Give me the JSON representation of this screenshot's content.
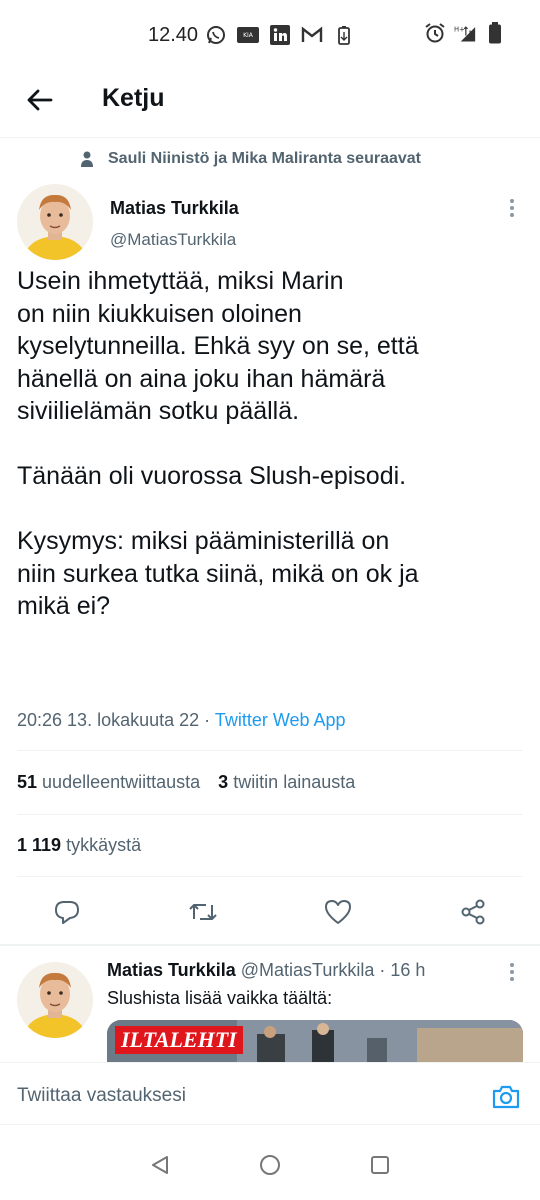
{
  "status_bar": {
    "time": "12.40",
    "left_icons": [
      "whatsapp-icon",
      "kia-connect-icon",
      "linkedin-icon",
      "gmail-icon",
      "battery-saver-icon"
    ],
    "right_icons": [
      "alarm-icon",
      "network-h-plus-icon",
      "signal-icon",
      "battery-icon"
    ]
  },
  "header": {
    "title": "Ketju"
  },
  "social_context": {
    "text": "Sauli Niinistö ja Mika Maliranta seuraavat"
  },
  "tweet": {
    "author_name": "Matias Turkkila",
    "author_handle": "@MatiasTurkkila",
    "text": "Usein ihmetyttää, miksi Marin\non niin kiukkuisen oloinen\nkyselytunneilla. Ehkä syy on se, että\nhänellä on aina joku ihan hämärä\nsiviilielämän sotku päällä.\n\nTänään oli vuorossa Slush-episodi.\n\nKysymys: miksi pääministerillä on\nniin surkea tutka siinä, mikä on ok ja\nmikä ei?",
    "timestamp": "20:26 13. lokakuuta 22",
    "separator": " · ",
    "source": "Twitter Web App",
    "retweets_count": "51",
    "retweets_label": "uudelleentwiittausta",
    "quotes_count": "3",
    "quotes_label": "twiitin lainausta",
    "likes_count": "1 119",
    "likes_label": "tykkäystä"
  },
  "reply": {
    "author_name": "Matias Turkkila",
    "author_handle": "@MatiasTurkkila",
    "time": "· 16 h",
    "text": "Slushista lisää vaikka täältä:",
    "card_logo": "ILTALEHTI"
  },
  "compose": {
    "placeholder": "Twiittaa vastauksesi"
  },
  "colors": {
    "accent": "#1d9bf0",
    "secondary_text": "#536471",
    "primary_text": "#0f1419"
  }
}
